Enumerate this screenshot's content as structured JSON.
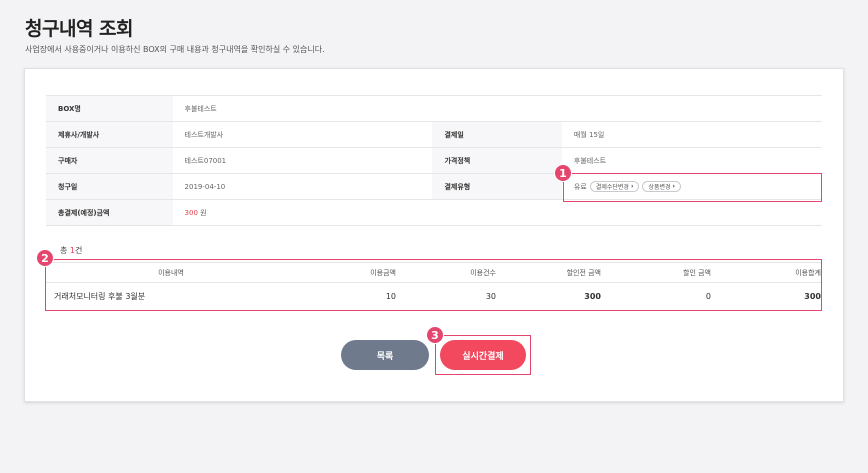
{
  "header": {
    "title": "청구내역 조회",
    "description": "사업장에서 사용중이거나 이용하신 BOX의 구매 내용과 청구내역을 확인하실 수 있습니다."
  },
  "info": {
    "box_label": "BOX명",
    "box_value": "후불테스트",
    "partner_label": "제휴사/개발사",
    "partner_value": "테스트개발사",
    "payday_label": "결제일",
    "payday_value": "매월 15일",
    "buyer_label": "구매자",
    "buyer_value": "테스트07001",
    "price_policy_label": "가격정책",
    "price_policy_value": "후불테스트",
    "billing_date_label": "청구일",
    "billing_date_value": "2019-04-10",
    "payment_type_label": "결제유형",
    "payment_type_value": "유료",
    "change_method_label": "결제수단변경",
    "change_product_label": "상품변경",
    "total_label": "총결제(예정)금액",
    "total_amount": "300",
    "total_unit": "원"
  },
  "usage": {
    "count_prefix": "총",
    "count": "1",
    "count_suffix": "건",
    "headers": [
      "이용내역",
      "이용금액",
      "이용건수",
      "할인전 금액",
      "할인 금액",
      "이용합계"
    ],
    "rows": [
      [
        "거래처모니터링 후불 3월분",
        "10",
        "30",
        "300",
        "0",
        "300"
      ]
    ]
  },
  "buttons": {
    "list": "목록",
    "pay": "실시간결제"
  },
  "badges": {
    "one": "1",
    "two": "2",
    "three": "3"
  },
  "colors": {
    "accent": "#e5466e",
    "pay_button": "#f2495e",
    "list_button": "#6f7b8c"
  }
}
